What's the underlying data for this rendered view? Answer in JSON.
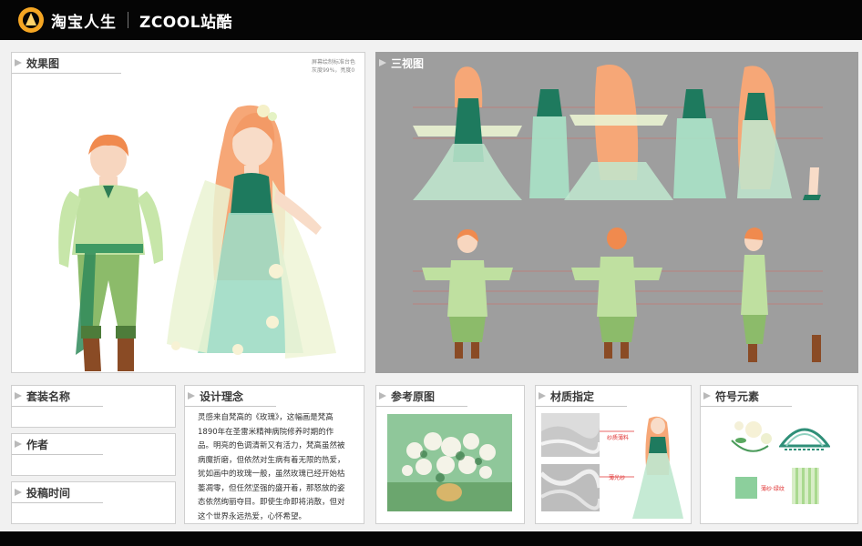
{
  "brand": {
    "taobao_text": "淘宝人生",
    "zcool_text": "ZCOOL站酷"
  },
  "panels": {
    "effect": {
      "title": "效果图",
      "note_line1": "屏幕绘制标准台色",
      "note_line2": "灰度99%，亮度0"
    },
    "three_view": {
      "title": "三视图"
    },
    "suit_name": {
      "title": "套装名称"
    },
    "author": {
      "title": "作者"
    },
    "submit_time": {
      "title": "投稿时间"
    },
    "design_concept": {
      "title": "设计理念",
      "text": "灵感来自梵高的《玫瑰》，这幅画是梵高1890年在圣雷米精神病院修养时期的作品。明亮的色调清新又有活力，梵高虽然被病魔折磨，但依然对生病有着无限的热爱，犹如画中的玫瑰一般，虽然玫瑰已经开始枯萎凋零，但任然坚强的盛开着，那怒放的姿态依然绚丽夺目。即使生命即将消散，但对这个世界永远热爱，心怀希望。"
    },
    "reference": {
      "title": "参考原图"
    },
    "material": {
      "title": "材质指定",
      "label_1": "纱质薄料",
      "label_2": "薄光纱"
    },
    "symbol": {
      "title": "符号元素",
      "pattern_label": "薄纱·绿纹"
    }
  },
  "colors": {
    "topbar": "#050505",
    "panel_gray": "#9e9e9e",
    "green_dark": "#2f7d55",
    "green_light": "#b8e0a8",
    "hair_orange": "#f2935a"
  }
}
